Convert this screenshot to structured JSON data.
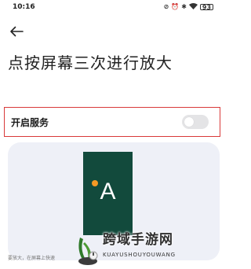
{
  "status_bar": {
    "time": "10:16",
    "battery": "93"
  },
  "header": {
    "title": "点按屏幕三次进行放大"
  },
  "service": {
    "label": "开启服务",
    "enabled": false
  },
  "preview": {
    "letter": "A",
    "colors": {
      "background": "#124a3c",
      "dot": "#f59a24"
    }
  },
  "description": "要放大，在屏幕上快速",
  "watermark": {
    "title": "跨域手游网",
    "subtitle": "KUAYUSHOUYOUWANG"
  },
  "colors": {
    "highlight_border": "#d93a3a",
    "card_background": "#eef0f7",
    "toggle_off": "#e4e4e6"
  }
}
